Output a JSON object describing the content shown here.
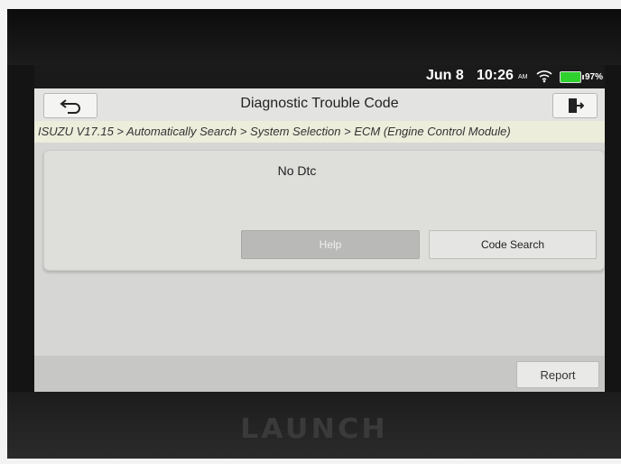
{
  "device": {
    "brand_logo": "LAUNCH"
  },
  "status_bar": {
    "date": "Jun 8",
    "time": "10:26",
    "ampm": "AM",
    "battery_level": "97%",
    "battery_color": "#2fd12f",
    "icons": [
      "wifi-icon",
      "battery-icon"
    ]
  },
  "header": {
    "title": "Diagnostic Trouble Code",
    "back_icon": "back-arrow-icon",
    "exit_icon": "exit-door-icon"
  },
  "breadcrumb": "ISUZU V17.15 > Automatically Search > System Selection > ECM (Engine Control Module)",
  "dtc_panel": {
    "message": "No Dtc",
    "help_label": "Help",
    "code_search_label": "Code Search"
  },
  "footer": {
    "report_label": "Report"
  }
}
